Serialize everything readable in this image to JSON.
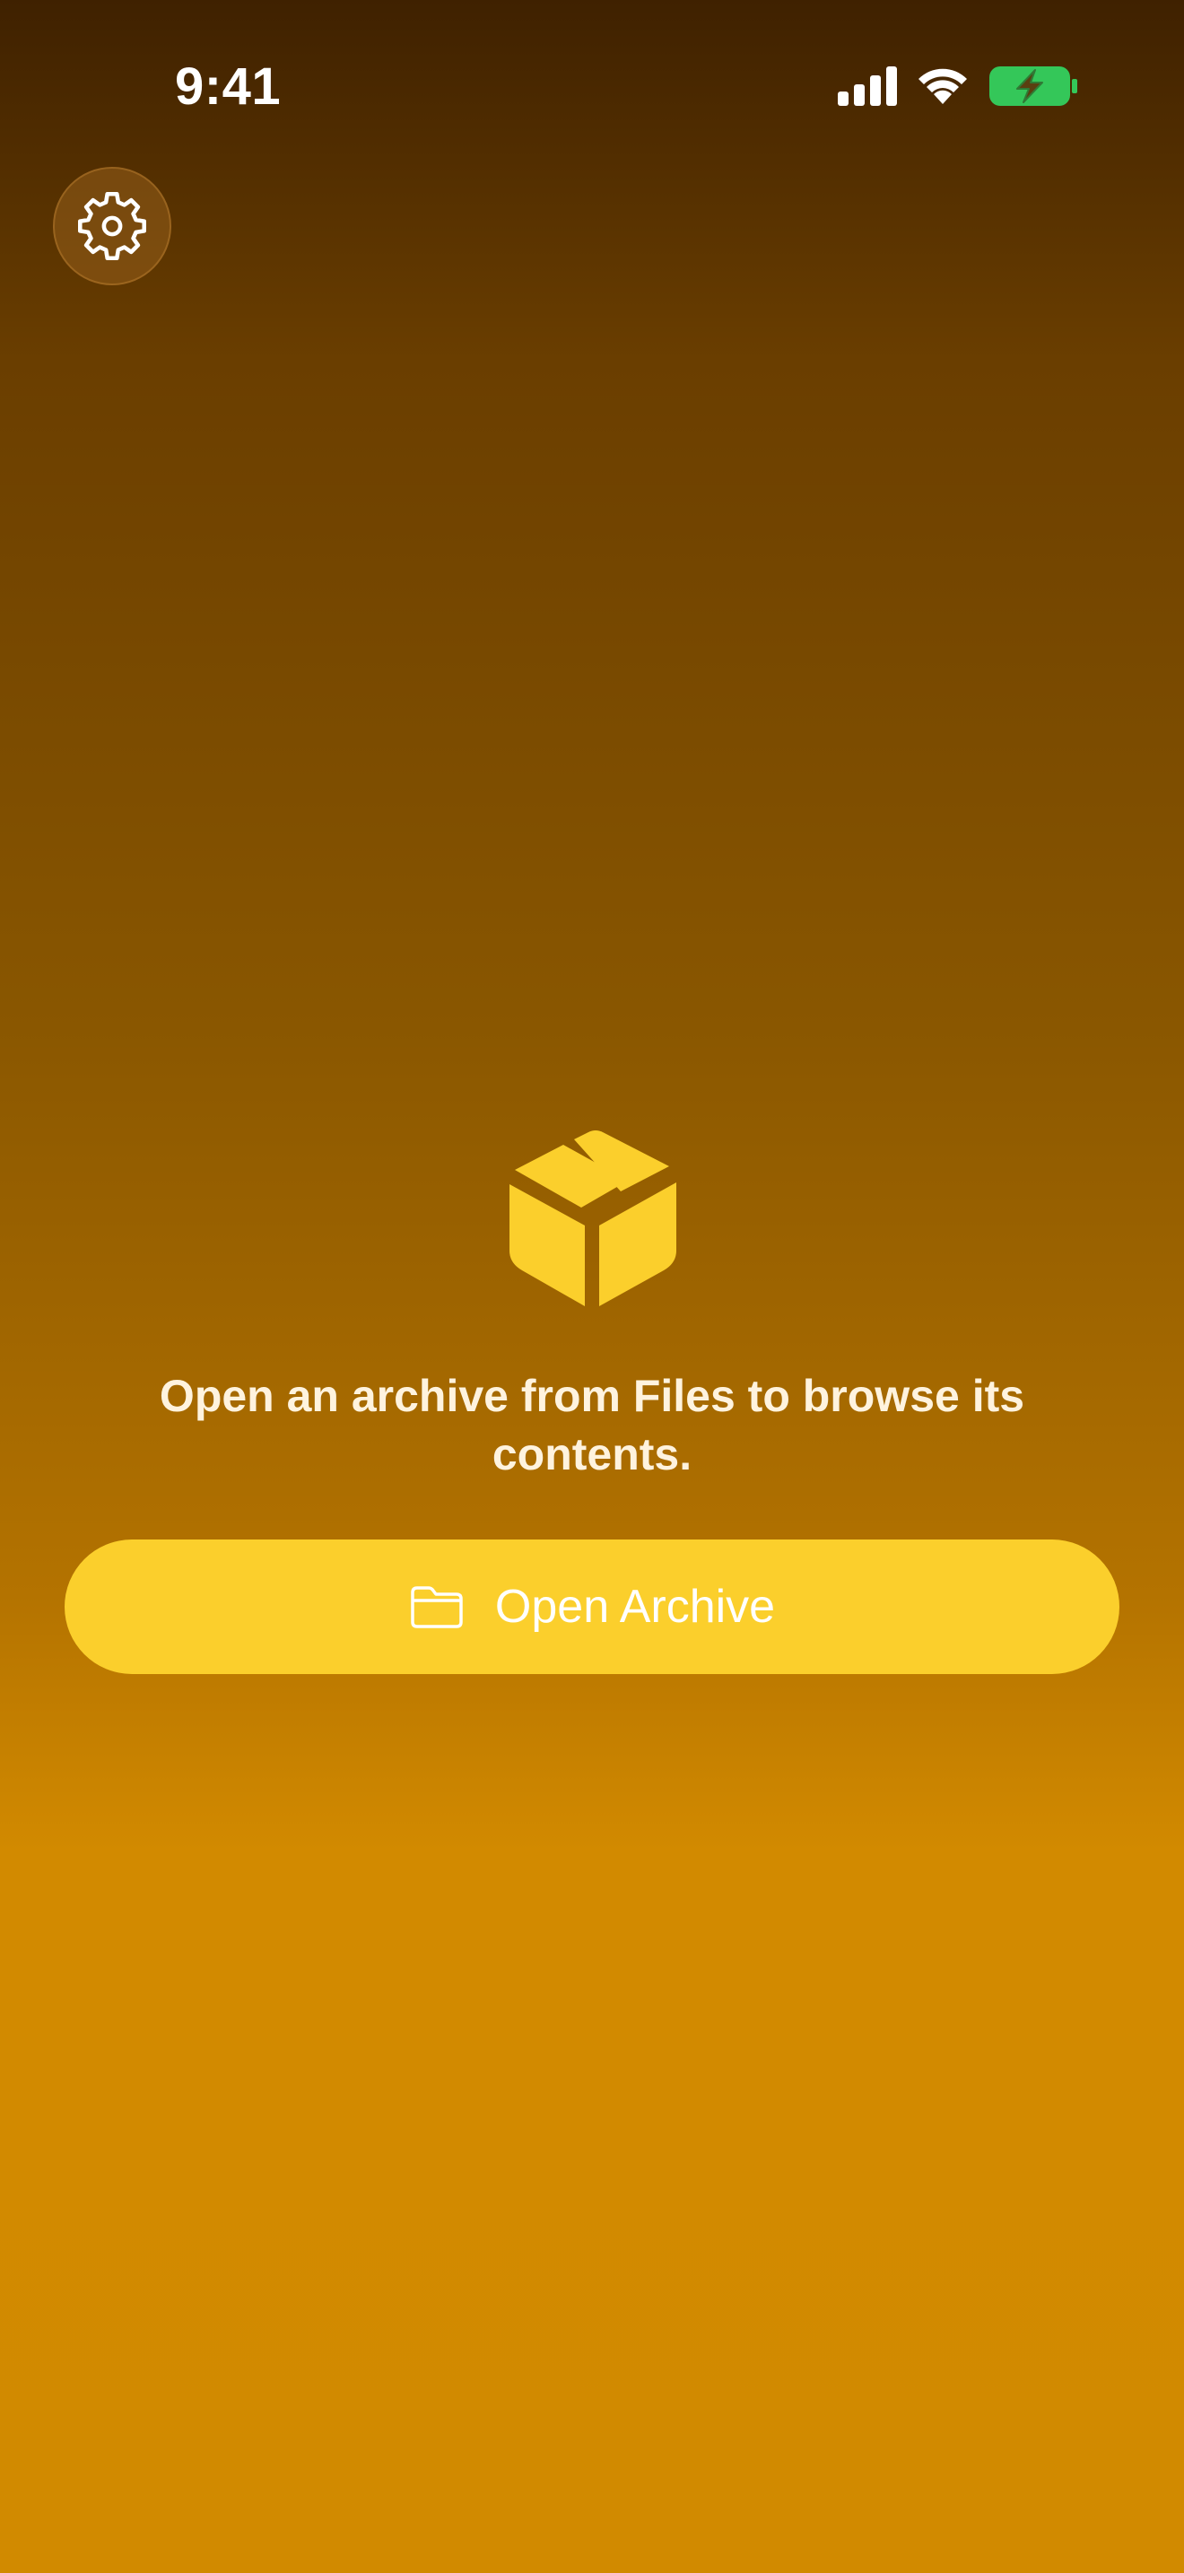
{
  "status_bar": {
    "time": "9:41",
    "signal_icon": "cellular-signal-icon",
    "wifi_icon": "wifi-icon",
    "battery_icon": "battery-charging-icon",
    "battery_color": "#34c759"
  },
  "toolbar": {
    "settings_icon": "gear-icon"
  },
  "empty_state": {
    "icon": "shipping-box-icon",
    "icon_color": "#fbcf2c",
    "message": "Open an archive from Files to browse its contents."
  },
  "open_button": {
    "icon": "folder-icon",
    "label": "Open Archive",
    "color": "#fbcf2c"
  }
}
